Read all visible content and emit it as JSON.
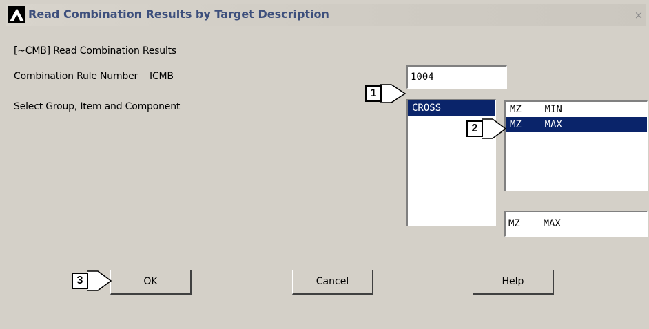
{
  "window": {
    "title": "Read Combination Results by Target Description",
    "close_glyph": "×",
    "logo_icon": "ansys-logo-icon"
  },
  "form": {
    "command_label": "[~CMB] Read Combination Results",
    "rule_label": "Combination Rule Number    ICMB",
    "rule_value": "1004",
    "select_label": "Select Group, Item and Component",
    "groups": [
      {
        "label": "CROSS",
        "selected": true
      }
    ],
    "items": [
      {
        "label": "MZ    MIN",
        "selected": false
      },
      {
        "label": "MZ    MAX",
        "selected": true
      }
    ],
    "item_value": "MZ    MAX"
  },
  "buttons": {
    "ok": "OK",
    "cancel": "Cancel",
    "help": "Help"
  },
  "callouts": [
    "1",
    "2",
    "3"
  ],
  "colors": {
    "dialog_bg": "#d4d0c8",
    "selection": "#0a246a",
    "title_text": "#3d4f7c"
  }
}
